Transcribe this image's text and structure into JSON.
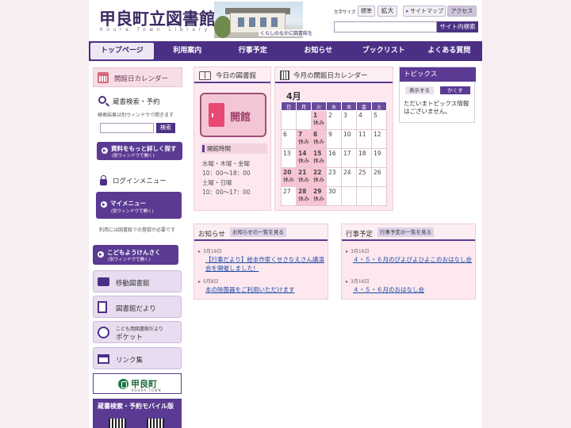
{
  "header": {
    "logo": "甲良町立図書館",
    "logo_sub": "Koura Town Library",
    "photo_caption": "くらしのなかに図書館を",
    "font_size_label": "文字サイズ",
    "font_standard": "標準",
    "font_large": "拡大",
    "sitemap": "サイトマップ",
    "access": "アクセス",
    "search_placeholder": "",
    "search_button": "サイト内検索"
  },
  "nav": [
    "トップページ",
    "利用案内",
    "行事予定",
    "お知らせ",
    "ブックリスト",
    "よくある質問"
  ],
  "left": {
    "calendar_link": "開館日カレンダー",
    "search_title": "蔵書検索・予約",
    "search_note": "検索結果は別ウィンドウで開きます",
    "search_button": "検索",
    "detail_search": "資料をもっと詳しく探す",
    "detail_search_note": "(別ウィンドウで開く)",
    "login_title": "ログインメニュー",
    "my_menu": "マイメニュー",
    "my_menu_note": "(別ウィンドウで開く)",
    "login_note": "利用には図書館での登録が必要です",
    "kids_search": "こどもようけんさく",
    "kids_search_note": "(別ウィンドウで開く)",
    "links": [
      {
        "label": "移動図書館",
        "icon": "bus-icon"
      },
      {
        "label": "図書館だより",
        "icon": "document-icon"
      },
      {
        "label": "ポケット",
        "sub": "こども用図書館だより",
        "icon": "child-icon"
      },
      {
        "label": "リンク集",
        "icon": "window-icon"
      }
    ],
    "town_banner": "甲良町",
    "town_banner_sub": "KOURA TOWN",
    "mobile": "蔵書検索・予約モバイル版"
  },
  "today": {
    "title": "今日の図書館",
    "status": "開館",
    "hours_title": "開館時間",
    "hours": [
      "水曜・木曜・金曜",
      "10：00〜18：00",
      "土曜・日曜",
      "10：00〜17：00"
    ]
  },
  "calendar": {
    "title": "今月の開館日カレンダー",
    "month": "4月",
    "weekdays": [
      "日",
      "月",
      "火",
      "水",
      "木",
      "金",
      "土"
    ],
    "closed_label": "休み",
    "weeks": [
      [
        {
          "d": ""
        },
        {
          "d": ""
        },
        {
          "d": "1",
          "c": true
        },
        {
          "d": "2"
        },
        {
          "d": "3"
        },
        {
          "d": "4"
        },
        {
          "d": "5"
        }
      ],
      [
        {
          "d": "6"
        },
        {
          "d": "7",
          "c": true
        },
        {
          "d": "8",
          "c": true
        },
        {
          "d": "9"
        },
        {
          "d": "10"
        },
        {
          "d": "11"
        },
        {
          "d": "12"
        }
      ],
      [
        {
          "d": "13"
        },
        {
          "d": "14",
          "c": true
        },
        {
          "d": "15",
          "c": true
        },
        {
          "d": "16"
        },
        {
          "d": "17"
        },
        {
          "d": "18"
        },
        {
          "d": "19"
        }
      ],
      [
        {
          "d": "20",
          "c": true
        },
        {
          "d": "21",
          "c": true
        },
        {
          "d": "22",
          "c": true
        },
        {
          "d": "23"
        },
        {
          "d": "24"
        },
        {
          "d": "25"
        },
        {
          "d": "26"
        }
      ],
      [
        {
          "d": "27"
        },
        {
          "d": "28",
          "c": true
        },
        {
          "d": "29",
          "c": true
        },
        {
          "d": "30"
        },
        {
          "d": ""
        },
        {
          "d": ""
        },
        {
          "d": ""
        }
      ]
    ]
  },
  "topics": {
    "title": "トピックス",
    "show": "表示する",
    "hide": "かくす",
    "text": "ただいまトピックス情報はございません。"
  },
  "news": {
    "title": "お知らせ",
    "more": "お知らせの一覧を見る",
    "items": [
      {
        "date": "3月19日",
        "text": "【行事だより】絵本作家くせさなえさん講演会を開催しました！"
      },
      {
        "date": "5月8日",
        "text": "本の除菌器をご利用いただけます"
      }
    ]
  },
  "events": {
    "title": "行事予定",
    "more": "行事予定の一覧を見る",
    "items": [
      {
        "date": "3月16日",
        "text": "４・５・６月のぴよぴよひよこのおはなし会"
      },
      {
        "date": "3月16日",
        "text": "４・５・６月のおはなし会"
      }
    ]
  }
}
